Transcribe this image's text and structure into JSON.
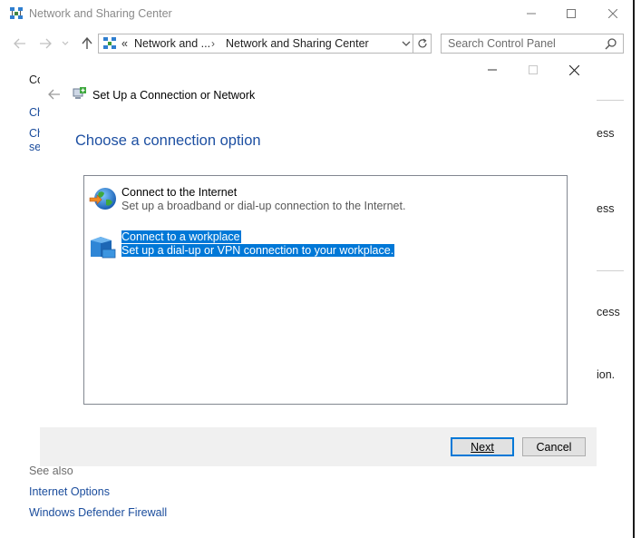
{
  "window": {
    "title": "Network and Sharing Center"
  },
  "address_bar": {
    "prefix": "«",
    "crumb1": "Network and ...",
    "separator": "›",
    "crumb2": "Network and Sharing Center"
  },
  "search": {
    "placeholder": "Search Control Panel"
  },
  "background": {
    "sidebar_fragments": [
      "Co",
      "Ch",
      "Ch",
      "se"
    ],
    "right_fragments": [
      "ess",
      "ess",
      "cess",
      "ion."
    ],
    "see_also_label": "See also",
    "see_also_links": [
      "Internet Options",
      "Windows Defender Firewall"
    ]
  },
  "dialog": {
    "title": "Set Up a Connection or Network",
    "heading": "Choose a connection option",
    "options": [
      {
        "title": "Connect to the Internet",
        "description": "Set up a broadband or dial-up connection to the Internet.",
        "icon": "globe-network-icon",
        "selected": false
      },
      {
        "title": "Connect to a workplace",
        "description": "Set up a dial-up or VPN connection to your workplace.",
        "icon": "workplace-building-icon",
        "selected": true
      }
    ],
    "next_label": "Next",
    "cancel_label": "Cancel"
  },
  "colors": {
    "accent": "#0078d7",
    "heading_blue": "#1e50a2",
    "link_blue": "#1a4c9c",
    "footer_bg": "#f0f0f0"
  }
}
